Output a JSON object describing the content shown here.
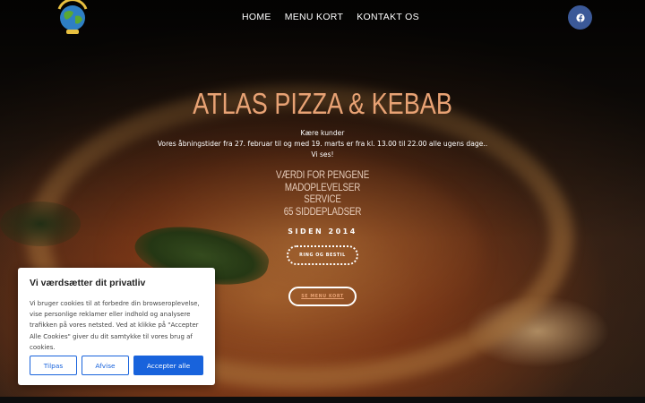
{
  "nav": {
    "items": [
      "HOME",
      "MENU KORT",
      "KONTAKT OS"
    ]
  },
  "logo": {
    "icon": "globe-logo-icon",
    "text": "ATLAS PIZZA & KEBAB"
  },
  "social": {
    "icon": "facebook-icon",
    "color": "#3b5998"
  },
  "hero": {
    "title": "ATLAS PIZZA & KEBAB",
    "intro": [
      "Kære kunder",
      "Vores åbningstider fra 27. februar til og med 19. marts er fra kl. 13.00 til 22.00 alle ugens dage..",
      "Vi ses!"
    ],
    "features": [
      "VÆRDI FOR PENGENE",
      "MADOPLEVELSER",
      "SERVICE",
      "65 SIDDEPLADSER"
    ],
    "since": "SIDEN 2014",
    "call_button": "RING OG BESTIL",
    "menu_button": "SE MENU KORT",
    "accent_color": "#e8a274"
  },
  "cookie": {
    "title": "Vi værdsætter dit privatliv",
    "text": "Vi bruger cookies til at forbedre din browseroplevelse, vise personlige reklamer eller indhold og analysere trafikken på vores netsted. Ved at klikke på \"Accepter Alle Cookies\" giver du dit samtykke til vores brug af cookies.",
    "customize": "Tilpas",
    "reject": "Afvise",
    "accept": "Accepter alle",
    "button_color": "#1863dc"
  }
}
